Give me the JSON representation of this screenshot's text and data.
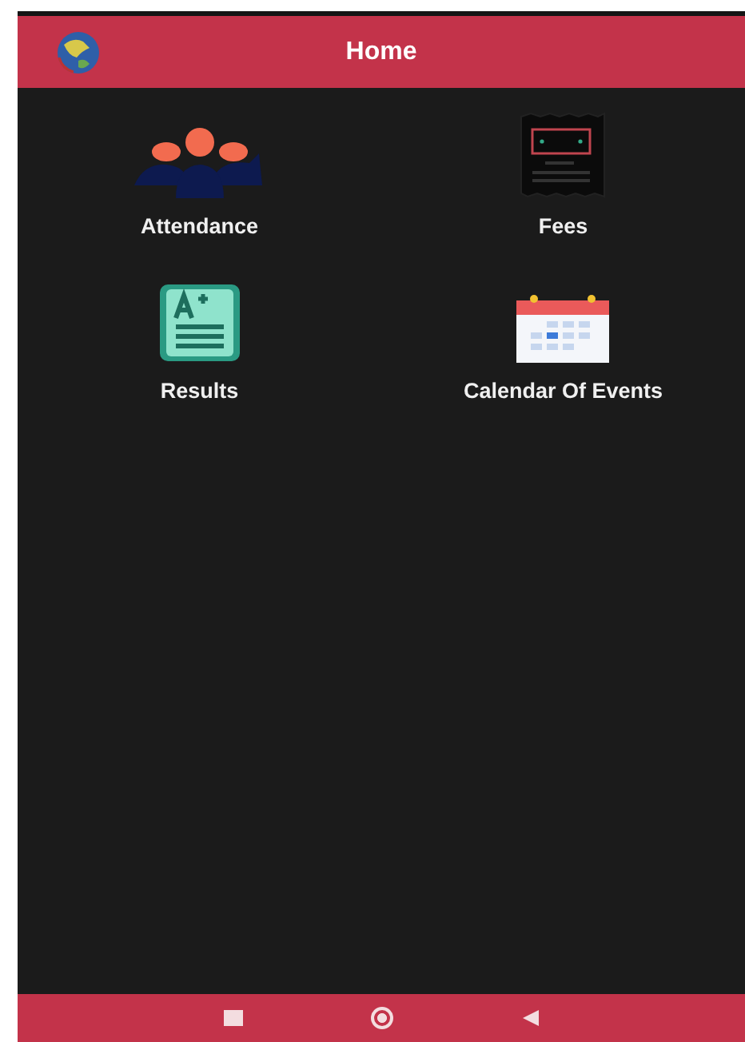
{
  "app_bar": {
    "title": "Home"
  },
  "menu": [
    {
      "label": "Attendance",
      "kind": "attendance"
    },
    {
      "label": "Fees",
      "kind": "fees"
    },
    {
      "label": "Results",
      "kind": "results"
    },
    {
      "label": "Calendar Of Events",
      "kind": "calendar"
    }
  ]
}
